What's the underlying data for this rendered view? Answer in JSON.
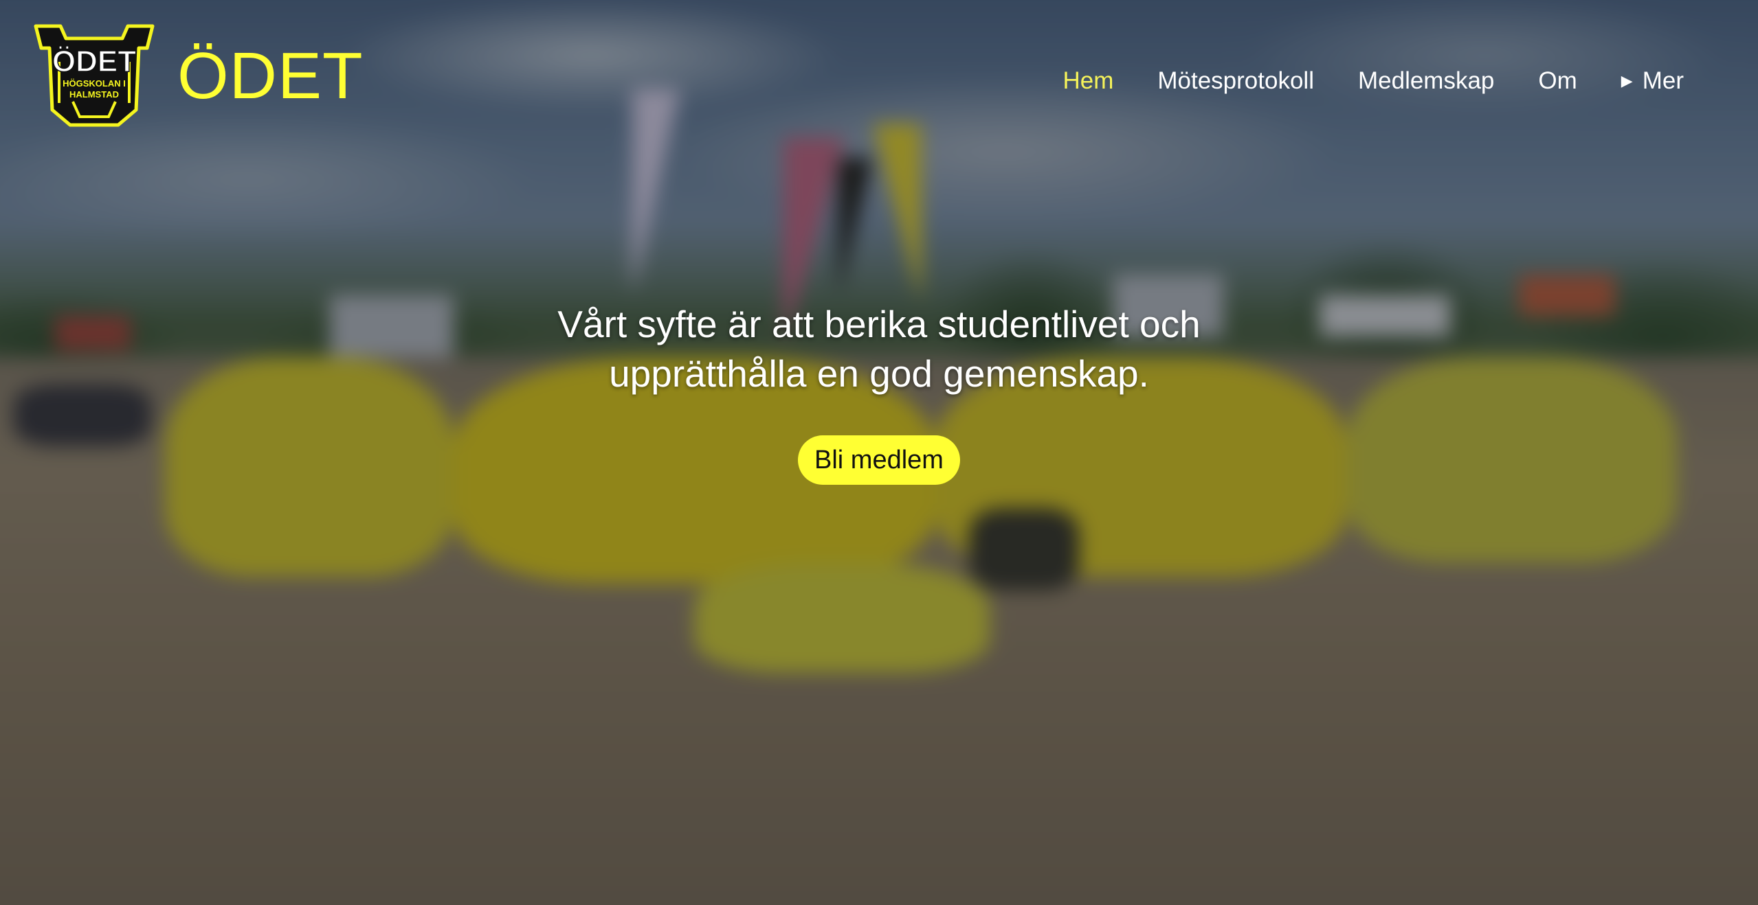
{
  "brand": {
    "logo_text": "ÖDET",
    "logo_subtext_line1": "HÖGSKOLAN I",
    "logo_subtext_line2": "HALMSTAD",
    "title": "ÖDET"
  },
  "nav": {
    "items": [
      {
        "label": "Hem",
        "active": true
      },
      {
        "label": "Mötesprotokoll",
        "active": false
      },
      {
        "label": "Medlemskap",
        "active": false
      },
      {
        "label": "Om",
        "active": false
      }
    ],
    "more": {
      "icon": "triangle-right-icon",
      "label": "Mer"
    }
  },
  "hero": {
    "line1": "Vårt syfte är att berika studentlivet och",
    "line2": "upprätthålla en god gemenskap.",
    "cta_label": "Bli medlem"
  },
  "colors": {
    "accent_yellow": "#ffff33",
    "active_nav": "#f6f35a",
    "text_light": "#ffffff"
  }
}
